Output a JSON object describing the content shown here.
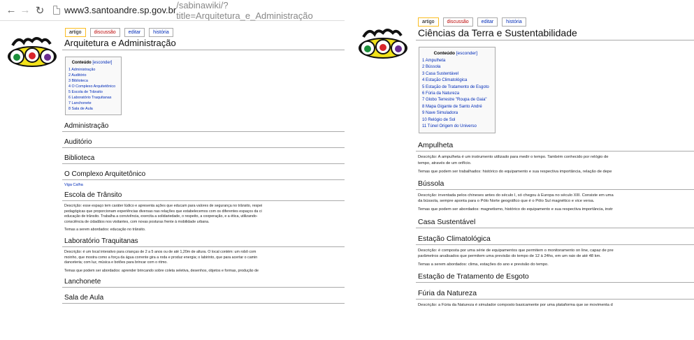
{
  "browser": {
    "url_host": "www3.santoandre.sp.gov.br",
    "url_path": "/sabinawiki/?title=Arquitetura_e_Administração"
  },
  "left": {
    "tabs": [
      "artigo",
      "discussão",
      "editar",
      "história"
    ],
    "title": "Arquitetura e Administração",
    "toc": {
      "title": "Conteúdo",
      "toggle": "[esconder]",
      "items": [
        "1 Administração",
        "2 Auditório",
        "3 Biblioteca",
        "4 O Complexo Arquitetônico",
        "5 Escola de Trânsito",
        "6 Laboratório Traquitanas",
        "7 Lanchonete",
        "8 Sala de Aula"
      ]
    },
    "sections": {
      "administracao": "Administração",
      "auditorio": "Auditório",
      "biblioteca": "Biblioteca",
      "complexo": "O Complexo Arquitetônico",
      "complexo_link": "Viga Calha",
      "escola": "Escola de Trânsito",
      "escola_p1": "Descrição: esse espaço tem caráter lúdico e apresenta ações que educam para valores de segurança no trânsito, respei",
      "escola_p2": "pedagógicas que proporcionam experiências diversas nas relações que estabelecemos com os diferentes espaços da ci",
      "escola_p3": "educação de trânsito. Trabalha a convivência, exercita a solidariedade, o respeito, a cooperação, e a ética, utilizando-",
      "escola_p4": "consciência de cidadãos nos visitantes, com novas posturas frente à mobilidade urbana.",
      "escola_temas": "Temas a serem abordados: educação no trânsito.",
      "laboratorio": "Laboratório Traquitanas",
      "lab_p1": "Descrição: é um local interativo para crianças de 2 a 5 anos ou de até 1,20m de altura. O local contém: um robô com",
      "lab_p2": "moinho, que mostra como a força da água corrente gira a roda e produz energia; o labirinto, que para acertar o camin",
      "lab_p3": "danceteria; com luz, música e botões para brincar com o ritmo.",
      "lab_temas": "Temas que podem ser abordados: aprender brincando sobre coleta seletiva, desenhos, objetos e formas, produção de",
      "lanchonete": "Lanchonete",
      "sala": "Sala de Aula"
    }
  },
  "right": {
    "tabs": [
      "artigo",
      "discussão",
      "editar",
      "história"
    ],
    "title": "Ciências da Terra e Sustentabilidade",
    "toc": {
      "title": "Conteúdo",
      "toggle": "[esconder]",
      "items": [
        "1 Ampulheta",
        "2 Bússola",
        "3 Casa Sustentável",
        "4 Estação Climatológica",
        "5 Estação de Tratamento de Esgoto",
        "6 Fúria da Natureza",
        "7 Globo Terrestre \"Roupa de Gaia\"",
        "8 Mapa Gigante de Santo André",
        "9 Nave Simuladora",
        "10 Relógio de Sol",
        "11 Túnel Origem do Universo"
      ]
    },
    "sections": {
      "ampulheta": "Ampulheta",
      "amp_p1": "Descrição: A ampulheta é um instrumento utilizado para medir o tempo. Também conhecido por relógio de",
      "amp_p2": "tempo, através de um orifício.",
      "amp_temas": "Temas que podem ser trabalhados: histórico do equipamento e sua respectiva importância, relação de depe",
      "bussola": "Bússola",
      "bus_p1": "Descrição: inventada pelos chineses antes do século I, só chegou à Europa no século XIII. Consiste em uma",
      "bus_p2": "da bússola, sempre aponta para o Pólo Norte geográfico que é o Pólo Sul magnético e vice versa.",
      "bus_temas": "Temas que podem ser abordados: magnetismo, histórico do equipamento e sua respectiva importância, instr",
      "casa": "Casa Sustentável",
      "estacao": "Estação Climatológica",
      "est_p1": "Descrição: é composta por uma série de equipamentos que permitem o monitoramento on line, capaz de pre",
      "est_p2": "parâmetros analisados que permitem uma previsão do tempo de 12 à 24hs, em um raio de até 48 km.",
      "est_temas": "Temas a serem abordados: clima, estações do ano e previsão do tempo.",
      "esgoto": "Estação de Tratamento de Esgoto",
      "furia": "Fúria da Natureza",
      "furia_p1": "Descrição: a Fúria da Natureza é simulador composto basicamente por uma plataforma que se movimenta d"
    }
  },
  "colors": {
    "link": "#002bb8",
    "heading_border": "#aaaaaa",
    "tab_selected": "#fabd23"
  },
  "icons": [
    "back-arrow-icon",
    "forward-arrow-icon",
    "reload-icon",
    "page-icon",
    "sabina-logo"
  ]
}
